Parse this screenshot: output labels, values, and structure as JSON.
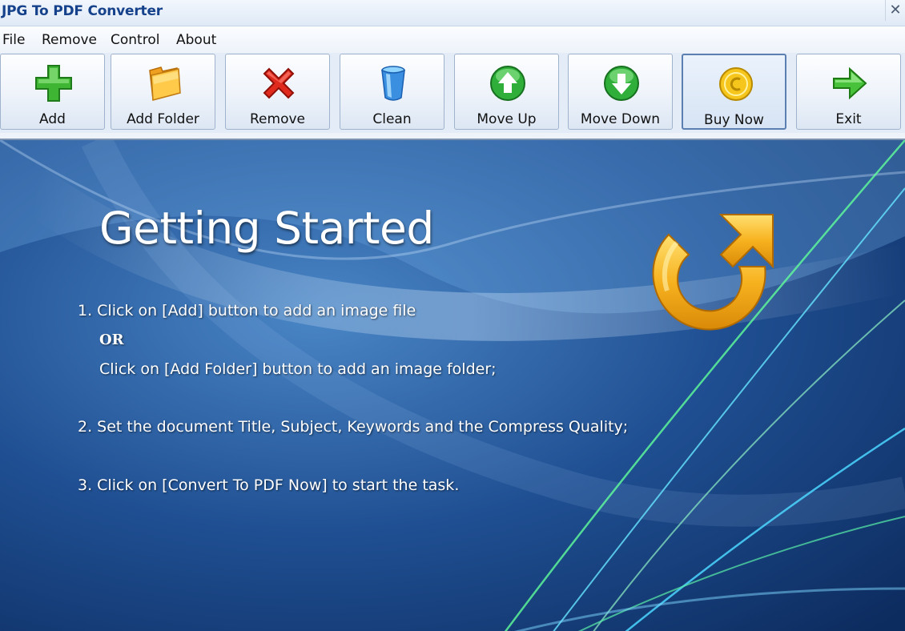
{
  "window": {
    "title": "JPG To PDF Converter",
    "close_glyph": "✕"
  },
  "menu": [
    {
      "label": "File"
    },
    {
      "label": "Remove"
    },
    {
      "label": "Control"
    },
    {
      "label": "About"
    }
  ],
  "toolbar": {
    "buttons": [
      {
        "label": "Add",
        "icon": "plus-icon"
      },
      {
        "label": "Add Folder",
        "icon": "folder-icon"
      },
      {
        "label": "Remove",
        "icon": "red-x-icon"
      },
      {
        "label": "Clean",
        "icon": "trash-bin-icon"
      },
      {
        "label": "Move Up",
        "icon": "up-arrow-circle-icon"
      },
      {
        "label": "Move Down",
        "icon": "down-arrow-circle-icon"
      },
      {
        "label": "Buy Now",
        "icon": "coin-icon"
      },
      {
        "label": "Exit",
        "icon": "exit-arrow-icon"
      }
    ]
  },
  "content": {
    "heading": "Getting Started",
    "step1": "1. Click on [Add] button to add an image file",
    "or": "OR",
    "step1b": "Click on [Add Folder] button to add an image folder;",
    "step2": "2. Set the document Title, Subject, Keywords and the Compress Quality;",
    "step3": "3. Click on [Convert To PDF Now] to start the task."
  },
  "colors": {
    "title_text": "#15428b",
    "background_blue": "#1d4a8a",
    "accent_orange": "#f5a623"
  }
}
